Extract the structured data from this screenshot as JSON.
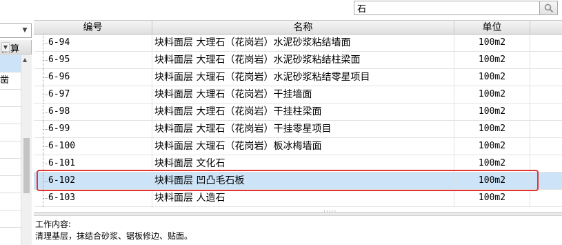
{
  "search": {
    "value": "石"
  },
  "left_panel": {
    "header": "预算",
    "rows": [
      "",
      "凿",
      "",
      "",
      "",
      "",
      "",
      "",
      "",
      ""
    ]
  },
  "table": {
    "columns": [
      "编号",
      "名称",
      "单位"
    ],
    "rows": [
      {
        "code": "6-94",
        "name": "块料面层 大理石（花岗岩）水泥砂浆粘结墙面",
        "unit": "100m2"
      },
      {
        "code": "6-95",
        "name": "块料面层 大理石（花岗岩）水泥砂浆粘结柱梁面",
        "unit": "100m2"
      },
      {
        "code": "6-96",
        "name": "块料面层 大理石（花岗岩）水泥砂浆粘结零星项目",
        "unit": "100m2"
      },
      {
        "code": "6-97",
        "name": "块料面层 大理石（花岗岩）干挂墙面",
        "unit": "100m2"
      },
      {
        "code": "6-98",
        "name": "块料面层 大理石（花岗岩）干挂柱梁面",
        "unit": "100m2"
      },
      {
        "code": "6-99",
        "name": "块料面层 大理石（花岗岩）干挂零星项目",
        "unit": "100m2"
      },
      {
        "code": "6-100",
        "name": "块料面层 大理石（花岗岩）板冰梅墙面",
        "unit": "100m2"
      },
      {
        "code": "6-101",
        "name": "块料面层 文化石",
        "unit": "100m2"
      },
      {
        "code": "6-102",
        "name": "块料面层 凹凸毛石板",
        "unit": "100m2"
      },
      {
        "code": "6-103",
        "name": "块料面层 人造石",
        "unit": "100m2"
      }
    ]
  },
  "description": {
    "title": "工作内容:",
    "text": "清理基层，抹结合砂浆、锯板修边、贴面。"
  },
  "colors": {
    "selection": "#cde3f7",
    "highlight": "#e23434"
  }
}
